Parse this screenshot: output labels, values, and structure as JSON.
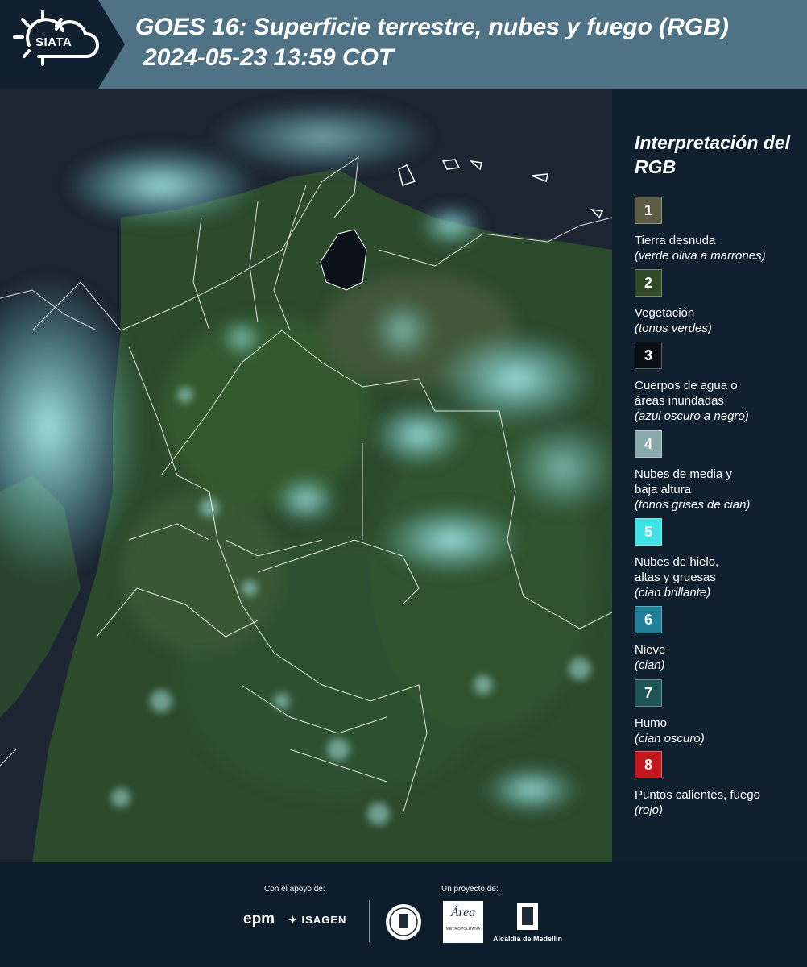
{
  "header": {
    "logo_text": "SIATA",
    "title": "GOES 16: Superficie terrestre, nubes y fuego (RGB)",
    "subtitle": "2024-05-23 13:59 COT"
  },
  "map": {
    "description_icon": "satellite-rgb-map"
  },
  "legend": {
    "title": "Interpretación del RGB",
    "items": [
      {
        "num": "1",
        "label": "Tierra desnuda",
        "desc": "(verde oliva a marrones)",
        "color": "#5d5c45"
      },
      {
        "num": "2",
        "label": "Vegetación",
        "desc": "(tonos verdes)",
        "color": "#2f4a25"
      },
      {
        "num": "3",
        "label": "Cuerpos de agua o áreas inundadas",
        "desc": "(azul oscuro a negro)",
        "color": "#0a0f16"
      },
      {
        "num": "4",
        "label": "Nubes de media y baja altura",
        "desc": "(tonos grises de cian)",
        "color": "#8aa9ab"
      },
      {
        "num": "5",
        "label": "Nubes de hielo, altas y gruesas",
        "desc": "(cian brillante)",
        "color": "#3fe2e2"
      },
      {
        "num": "6",
        "label": "Nieve",
        "desc": "(cian)",
        "color": "#1f7f97"
      },
      {
        "num": "7",
        "label": "Humo",
        "desc": "(cian oscuro)",
        "color": "#1f5457"
      },
      {
        "num": "8",
        "label": "Puntos calientes, fuego",
        "desc": "(rojo)",
        "color": "#c0181c"
      }
    ]
  },
  "footer": {
    "support_label": "Con el apoyo de:",
    "project_label": "Un proyecto de:",
    "epm": "epm",
    "isagen": "ISAGEN",
    "area_metro": "Área",
    "area_metro_sub": "METROPOLITANA",
    "alcaldia": "Alcaldía de Medellín"
  }
}
